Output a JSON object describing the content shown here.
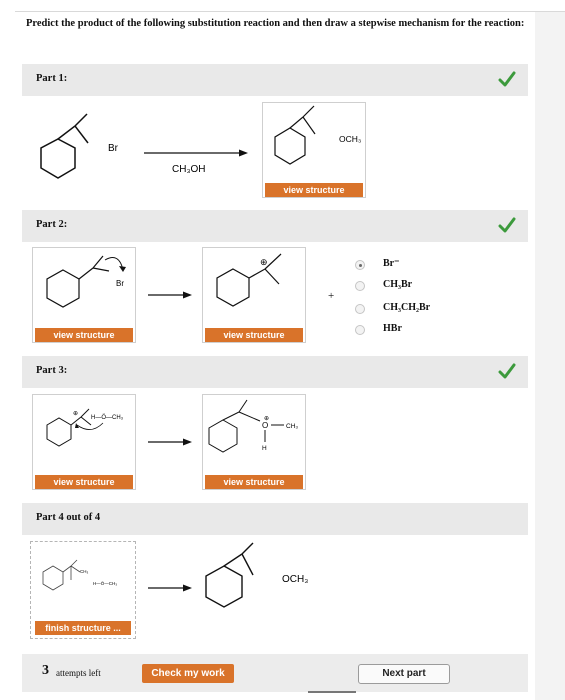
{
  "question": {
    "text": "Predict the product of the following substitution reaction and then draw a stepwise mechanism for the reaction:"
  },
  "parts": [
    {
      "label": "Part 1:",
      "status": "correct",
      "reactant_label": "Br",
      "reagent": "CH₃OH",
      "product_label": "OCH₃",
      "view_button": "view structure"
    },
    {
      "label": "Part 2:",
      "status": "correct",
      "leaving_label": "Br",
      "cation_charge": "⊕",
      "view_button_left": "view structure",
      "view_button_right": "view structure",
      "plus": "+",
      "options": [
        {
          "label": "Br⁻",
          "selected": true
        },
        {
          "label": "CH₃Br",
          "selected": false
        },
        {
          "label": "CH₃CH₂Br",
          "selected": false
        },
        {
          "label": "HBr",
          "selected": false
        }
      ]
    },
    {
      "label": "Part 3:",
      "status": "correct",
      "left_methanol": "H—Ö—CH₃",
      "right_o": "O",
      "right_ch3": "CH₃",
      "right_h": "H",
      "right_charge": "⊕",
      "view_button_left": "view structure",
      "view_button_right": "view structure"
    },
    {
      "label": "Part 4 out of 4",
      "status": "current",
      "left_ch3": "CH₃",
      "left_methanol": "H—Ö—CH₃",
      "product_label": "OCH₃",
      "finish_button": "finish structure ..."
    }
  ],
  "footer": {
    "attempts_count": "3",
    "attempts_text": "attempts left",
    "check_button": "Check my work",
    "next_button": "Next part"
  },
  "colors": {
    "accent": "#d9732a",
    "check_green": "#3c9a3c",
    "bar_gray": "#e9e9e9"
  }
}
